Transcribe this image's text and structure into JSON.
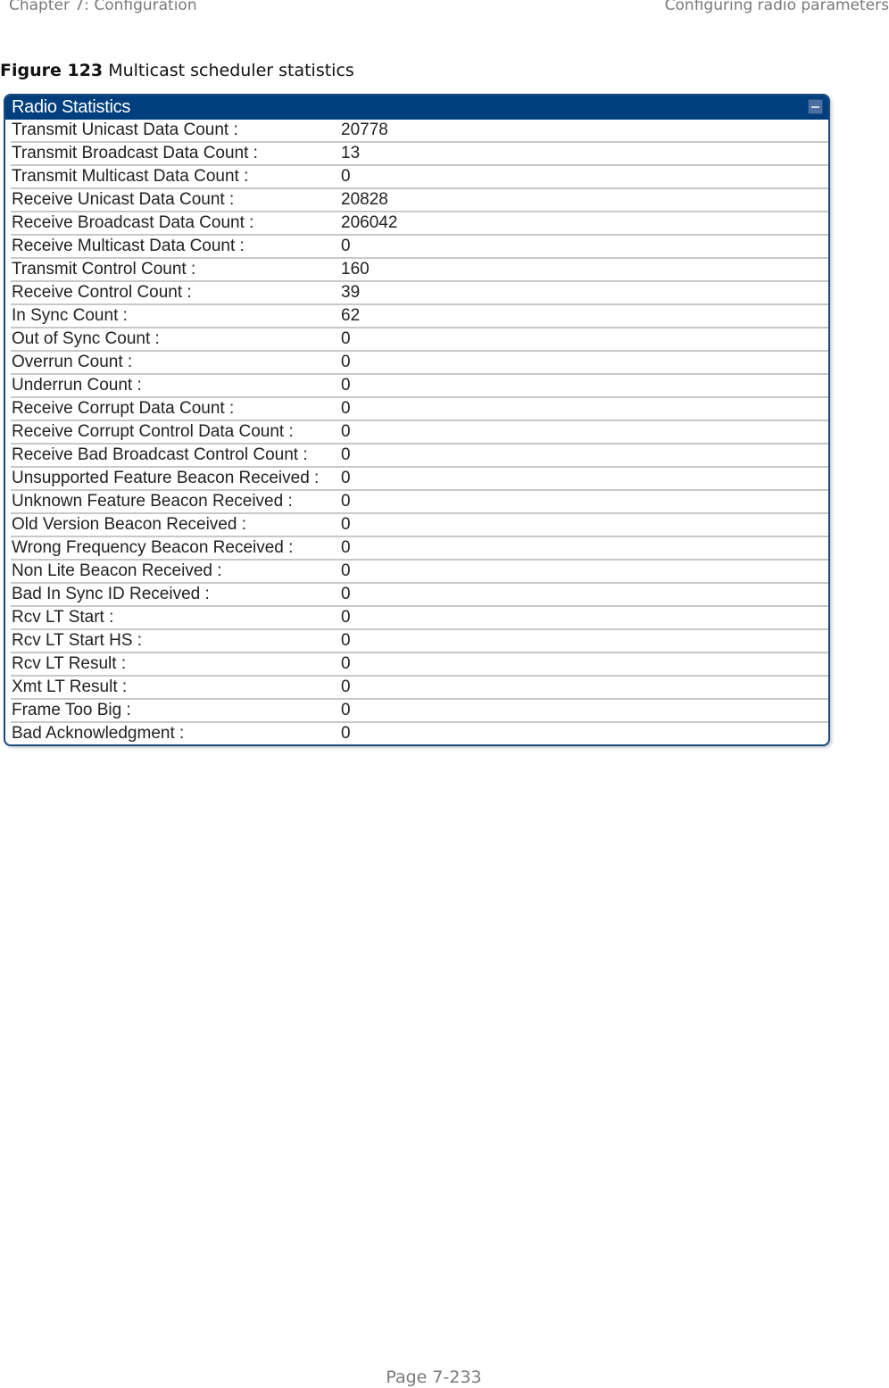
{
  "header": {
    "chapter": "Chapter 7:  Configuration",
    "section": "Configuring radio parameters"
  },
  "caption": {
    "label": "Figure 123",
    "text": " Multicast scheduler statistics"
  },
  "panel": {
    "title": "Radio Statistics",
    "collapse_icon": "collapse-icon",
    "rows": [
      {
        "label": "Transmit Unicast Data Count :",
        "value": "20778"
      },
      {
        "label": "Transmit Broadcast Data Count :",
        "value": "13"
      },
      {
        "label": "Transmit Multicast Data Count :",
        "value": "0"
      },
      {
        "label": "Receive Unicast Data Count :",
        "value": "20828"
      },
      {
        "label": "Receive Broadcast Data Count :",
        "value": "206042"
      },
      {
        "label": "Receive Multicast Data Count :",
        "value": "0"
      },
      {
        "label": "Transmit Control Count :",
        "value": "160"
      },
      {
        "label": "Receive Control Count :",
        "value": "39"
      },
      {
        "label": "In Sync Count :",
        "value": "62"
      },
      {
        "label": "Out of Sync Count :",
        "value": "0"
      },
      {
        "label": "Overrun Count :",
        "value": "0"
      },
      {
        "label": "Underrun Count :",
        "value": "0"
      },
      {
        "label": "Receive Corrupt Data Count :",
        "value": "0"
      },
      {
        "label": "Receive Corrupt Control Data Count :",
        "value": "0"
      },
      {
        "label": "Receive Bad Broadcast Control Count :",
        "value": "0"
      },
      {
        "label": "Unsupported Feature Beacon Received :",
        "value": "0"
      },
      {
        "label": "Unknown Feature Beacon Received :",
        "value": "0"
      },
      {
        "label": "Old Version Beacon Received :",
        "value": "0"
      },
      {
        "label": "Wrong Frequency Beacon Received :",
        "value": "0"
      },
      {
        "label": "Non Lite Beacon Received :",
        "value": "0"
      },
      {
        "label": "Bad In Sync ID Received :",
        "value": "0"
      },
      {
        "label": "Rcv LT Start :",
        "value": "0"
      },
      {
        "label": "Rcv LT Start HS :",
        "value": "0"
      },
      {
        "label": "Rcv LT Result :",
        "value": "0"
      },
      {
        "label": "Xmt LT Result :",
        "value": "0"
      },
      {
        "label": "Frame Too Big :",
        "value": "0"
      },
      {
        "label": "Bad Acknowledgment :",
        "value": "0"
      }
    ]
  },
  "footer": {
    "page": "Page 7-233"
  }
}
